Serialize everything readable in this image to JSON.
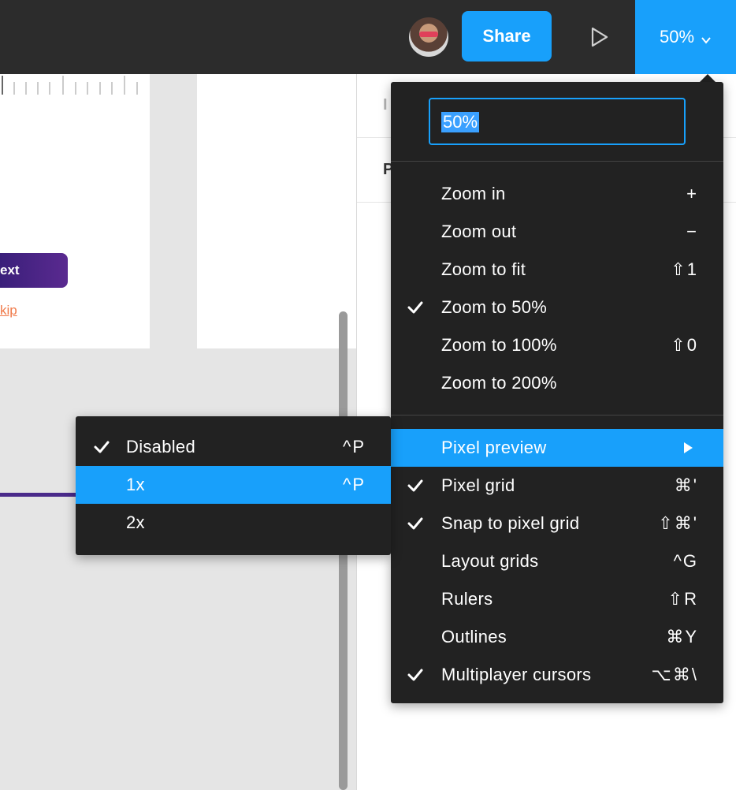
{
  "topbar": {
    "share_label": "Share",
    "zoom_label": "50%"
  },
  "canvas": {
    "next_button_label": "ext",
    "skip_link_label": "kip"
  },
  "right_panel": {
    "row1_letter": "I",
    "row2_letter": "P"
  },
  "zoom_menu": {
    "input_value": "50%",
    "items": [
      {
        "label": "Zoom in",
        "shortcut": "+",
        "checked": false
      },
      {
        "label": "Zoom out",
        "shortcut": "−",
        "checked": false
      },
      {
        "label": "Zoom to fit",
        "shortcut": "⇧1",
        "checked": false
      },
      {
        "label": "Zoom to 50%",
        "shortcut": "",
        "checked": true
      },
      {
        "label": "Zoom to 100%",
        "shortcut": "⇧0",
        "checked": false
      },
      {
        "label": "Zoom to 200%",
        "shortcut": "",
        "checked": false
      },
      {
        "label": "Pixel preview",
        "shortcut": "",
        "checked": false,
        "has_submenu": true,
        "highlighted": true
      },
      {
        "label": "Pixel grid",
        "shortcut": "⌘'",
        "checked": true
      },
      {
        "label": "Snap to pixel grid",
        "shortcut": "⇧⌘'",
        "checked": true
      },
      {
        "label": "Layout grids",
        "shortcut": "^G",
        "checked": false
      },
      {
        "label": "Rulers",
        "shortcut": "⇧R",
        "checked": false
      },
      {
        "label": "Outlines",
        "shortcut": "⌘Y",
        "checked": false
      },
      {
        "label": "Multiplayer cursors",
        "shortcut": "⌥⌘\\",
        "checked": true
      }
    ]
  },
  "pixel_preview_submenu": {
    "items": [
      {
        "label": "Disabled",
        "shortcut": "^P",
        "checked": true
      },
      {
        "label": "1x",
        "shortcut": "^P",
        "checked": false,
        "highlighted": true
      },
      {
        "label": "2x",
        "shortcut": "",
        "checked": false
      }
    ]
  },
  "colors": {
    "accent": "#18a0fb",
    "menu_bg": "#222222",
    "topbar_bg": "#2c2c2c"
  },
  "icons": {
    "play": "play-icon",
    "chevron": "chevron-down-icon",
    "check": "check-icon",
    "submenu_arrow": "triangle-right-icon"
  }
}
